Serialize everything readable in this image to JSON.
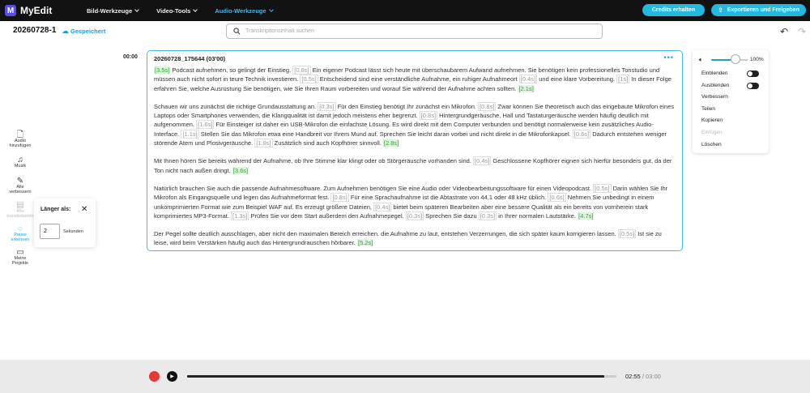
{
  "app": {
    "logo_letter": "M",
    "name": "MyEdit"
  },
  "nav": {
    "items": [
      {
        "label": "Bild-Werkzeuge"
      },
      {
        "label": "Video-Tools"
      },
      {
        "label": "Audio-Werkzeuge"
      }
    ],
    "active_index": 2
  },
  "header": {
    "credits_label": "Credits erhalten",
    "export_label": "Exportieren und Freigeben"
  },
  "document": {
    "title": "20260728-1",
    "status": "Gespeichert"
  },
  "search": {
    "placeholder": "Transkriptionsinhalt suchen"
  },
  "sidebar": {
    "items": [
      {
        "label_line1": "Audio",
        "label_line2": "hinzufügen"
      },
      {
        "label_line1": "Musik",
        "label_line2": ""
      },
      {
        "label_line1": "Alle",
        "label_line2": "verbessern"
      },
      {
        "label_line1": "Alle",
        "label_line2": "transkribieren"
      },
      {
        "label_line1": "Pause",
        "label_line2": "erkennen"
      },
      {
        "label_line1": "Meine",
        "label_line2": "Projekte"
      }
    ]
  },
  "popup": {
    "title": "Länger als:",
    "value": "2",
    "unit": "Sekunden"
  },
  "transcript": {
    "timestamp": "00:00",
    "header": "20260728_175644  (03'00)",
    "paragraphs": [
      [
        {
          "p": "[3.5s]",
          "end": true
        },
        {
          "t": " Podcast aufnehmen, so gelingt der Einstieg. "
        },
        {
          "p": "[0.8s]"
        },
        {
          "t": " Ein eigener Podcast lässt sich heute mit überschaubarem Aufwand aufnehmen. Sie benötigen kein professionelles Tonstudio und müssen auch nicht sofort in teure Technik investieren. "
        },
        {
          "p": "[0.5s]"
        },
        {
          "t": " Entscheidend sind eine verständliche Aufnahme, ein ruhiger Aufnahmeort "
        },
        {
          "p": "[0.4s]"
        },
        {
          "t": " und eine klare Vorbereitung. "
        },
        {
          "p": "[1s]"
        },
        {
          "t": " In dieser Folge erfahren Sie, welche Ausrüstung Sie benötigen, wie Sie Ihren Raum vorbereiten und worauf Sie während der Aufnahme achten sollten. "
        },
        {
          "p": "[2.1s]",
          "end": true
        }
      ],
      [
        {
          "t": "Schauen wir uns zunächst die richtige Grundausstattung an. "
        },
        {
          "p": "[0.3s]"
        },
        {
          "t": " Für den Einstieg benötigt Ihr zunächst ein Mikrofon. "
        },
        {
          "p": "[0.8s]"
        },
        {
          "t": " Zwar können Sie theoretisch auch das eingebaute Mikrofon eines Laptops oder Smartphones verwenden, die Klangqualität ist damit jedoch meistens eher begrenzt. "
        },
        {
          "p": "[0.8s]"
        },
        {
          "t": " Hintergrundgeräusche, Hall und Tastaturgeräusche werden häufig deutlich mit aufgenommen. "
        },
        {
          "p": "[1.6s]"
        },
        {
          "t": " Für Einsteiger ist daher ein USB-Mikrofon die einfachste Lösung. Es wird direkt mit dem Computer verbunden und benötigt normalerweise kein zusätzliches Audio-Interface. "
        },
        {
          "p": "[1.1s]"
        },
        {
          "t": " Stellen Sie das Mikrofon etwa eine Handbreit vor Ihrem Mund auf. Sprechen Sie leicht daran vorbei und nicht direkt in die Mikrofonkapsel. "
        },
        {
          "p": "[0.6s]"
        },
        {
          "t": " Dadurch entstehen weniger störende Atem und Plosivgeräusche. "
        },
        {
          "p": "[1.9s]"
        },
        {
          "t": " Zusätzlich sind auch Kopfhörer sinnvoll. "
        },
        {
          "p": "[2.8s]",
          "end": true
        }
      ],
      [
        {
          "t": "Mit Ihnen hören Sie bereits während der Aufnahme, ob Ihre Stimme klar klingt oder ob Störgeräusche vorhanden sind. "
        },
        {
          "p": "[0.4s]"
        },
        {
          "t": " Geschlossene Kopfhörer eignen sich hierfür besonders gut, da der Ton nicht nach außen dringt. "
        },
        {
          "p": "[3.6s]",
          "end": true
        }
      ],
      [
        {
          "t": "Natürlich brauchen Sie auch die passende Aufnahmesoftware. Zum Aufnehmen benötigen Sie eine Audio oder Videobearbeitungssoftware für einen Videopodcast. "
        },
        {
          "p": "[0.5s]"
        },
        {
          "t": " Darin wählen Sie Ihr Mikrofon als Eingangsquelle und legen das Aufnahmeformat fest. "
        },
        {
          "p": "[0.8s]"
        },
        {
          "t": " Für eine Sprachaufnahme ist die Abtastrate von 44,1 oder 48 kHz üblich. "
        },
        {
          "p": "[0.6s]"
        },
        {
          "t": " Nehmen Sie unbedingt in einem unkomprimierten Format wie zum Beispiel WAF auf. Es erzeugt größere Dateien, "
        },
        {
          "p": "[0.4s]"
        },
        {
          "t": " bietet beim späteren Bearbeiten aber eine bessere Qualität als ein bereits von vornherein stark komprimiertes MP3-Format. "
        },
        {
          "p": "[1.3s]"
        },
        {
          "t": " Prüfen Sie vor dem Start außerdem den Aufnahmepegel. "
        },
        {
          "p": "[0.3s]"
        },
        {
          "t": " Sprechen Sie dazu "
        },
        {
          "p": "[0.3s]"
        },
        {
          "t": " in Ihrer normalen Lautstärke. "
        },
        {
          "p": "[4.7s]",
          "end": true
        }
      ],
      [
        {
          "t": "Der Pegel sollte deutlich ausschlagen, aber nicht den maximalen Bereich erreichen. die Aufnahme zu laut, entstehen Verzerrungen, die sich später kaum korrigieren lassen. "
        },
        {
          "p": "[0.5s]"
        },
        {
          "t": " Ist sie zu leise, wird beim Verstärken häufig auch das Hintergrundrauschen hörbarer. "
        },
        {
          "p": "[5.2s]",
          "end": true
        }
      ]
    ]
  },
  "panel": {
    "volume_pct": "100%",
    "volume_level": 0.67,
    "items": [
      {
        "label": "Einblenden",
        "toggle": true
      },
      {
        "label": "Ausblenden",
        "toggle": true
      },
      {
        "label": "Verbessern"
      },
      {
        "label": "Teilen"
      },
      {
        "label": "Kopieren"
      },
      {
        "label": "Einfügen",
        "disabled": true
      },
      {
        "label": "Löschen"
      }
    ]
  },
  "player": {
    "current": "02:55",
    "separator": " / ",
    "total": "03:00",
    "progress": 0.972
  },
  "colors": {
    "accent": "#22b8e0",
    "pause_end": "#2aa52a"
  }
}
